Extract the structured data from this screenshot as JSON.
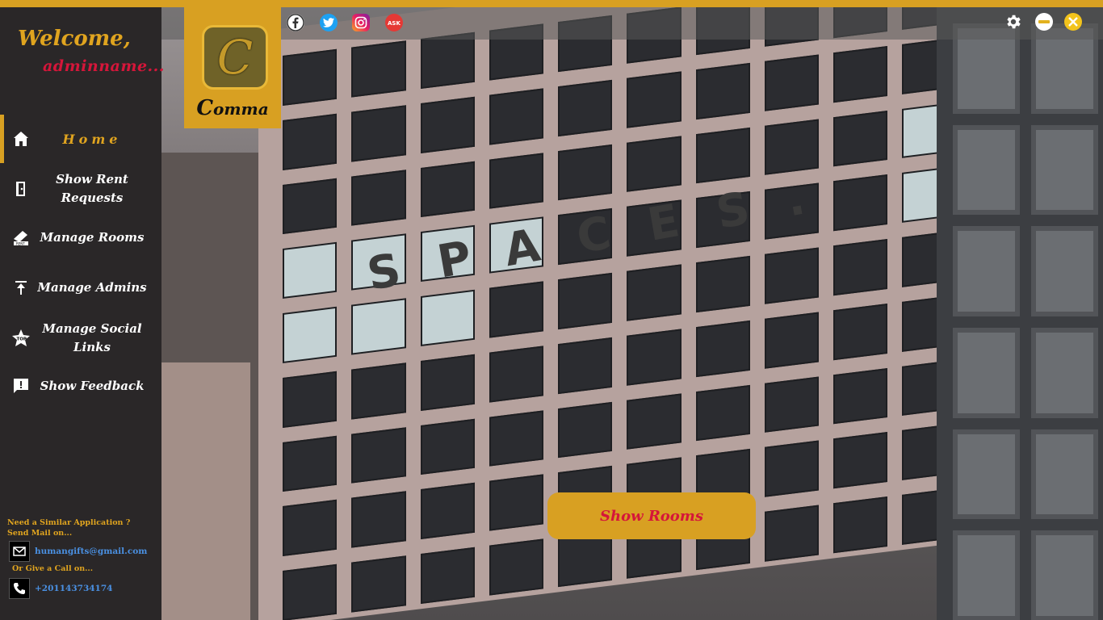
{
  "sidebar": {
    "welcome": "Welcome,",
    "username": "adminname...",
    "nav": [
      {
        "label": "Home",
        "icon": "home-icon"
      },
      {
        "label": "Show Rent Requests",
        "icon": "door-icon"
      },
      {
        "label": "Manage Rooms",
        "icon": "rent-icon"
      },
      {
        "label": "Manage Admins",
        "icon": "upload-icon"
      },
      {
        "label": "Manage Social Links",
        "icon": "top-badge-icon"
      },
      {
        "label": "Show Feedback",
        "icon": "feedback-icon"
      }
    ],
    "contact": {
      "heading": "Need a Similar Application ? Send Mail on...",
      "email": "humangifts@gmail.com",
      "call_heading": "Or Give a Call on...",
      "phone": "+201143734174"
    }
  },
  "logo": {
    "badge": "C",
    "initial": "C",
    "rest": "omma"
  },
  "photo_sign": "SPACES.",
  "social": [
    "facebook-icon",
    "twitter-icon",
    "instagram-icon",
    "ask-fm-icon"
  ],
  "window_controls": [
    "settings-icon",
    "minimize-icon",
    "close-icon"
  ],
  "main": {
    "show_rooms_label": "Show Rooms"
  },
  "colors": {
    "accent": "#d8a022",
    "sidebar": "#2a2728",
    "highlight": "#d5163a"
  }
}
